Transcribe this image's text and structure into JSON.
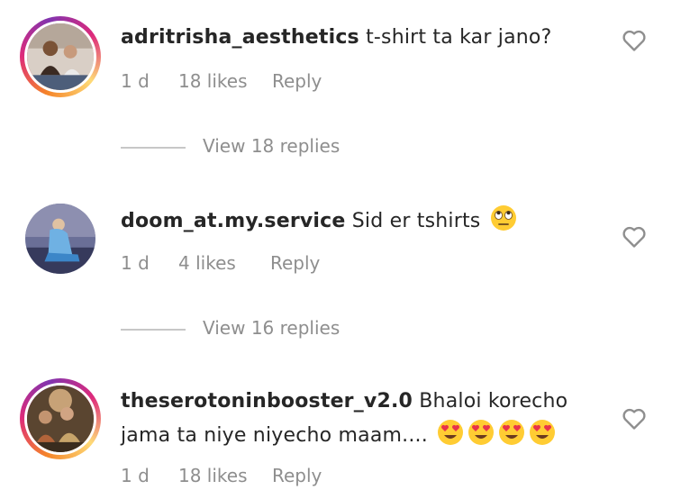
{
  "comments": [
    {
      "username": "adritrisha_aesthetics",
      "text": "t-shirt ta kar jano?",
      "time": "1 d",
      "likes": "18 likes",
      "reply_label": "Reply",
      "view_replies": "View 18 replies",
      "emojis": [],
      "avatar_icon": "couple-photo-avatar"
    },
    {
      "username": "doom_at.my.service",
      "text": "Sid er tshirts",
      "time": "1 d",
      "likes": "4 likes",
      "reply_label": "Reply",
      "view_replies": "View 16 replies",
      "emojis": [
        "face-with-rolling-eyes"
      ],
      "avatar_icon": "person-sitting-avatar"
    },
    {
      "username": "theserotoninbooster_v2.0",
      "text": "Bhaloi korecho jama ta niye niyecho maam....",
      "time": "1 d",
      "likes": "18 likes",
      "reply_label": "Reply",
      "emojis": [
        "heart-eyes",
        "heart-eyes",
        "heart-eyes",
        "heart-eyes"
      ],
      "avatar_icon": "group-photo-avatar"
    }
  ],
  "colors": {
    "text": "#262626",
    "muted": "#8e8e8e",
    "divider": "#c7c7c7",
    "emoji": "#ffcc33"
  }
}
